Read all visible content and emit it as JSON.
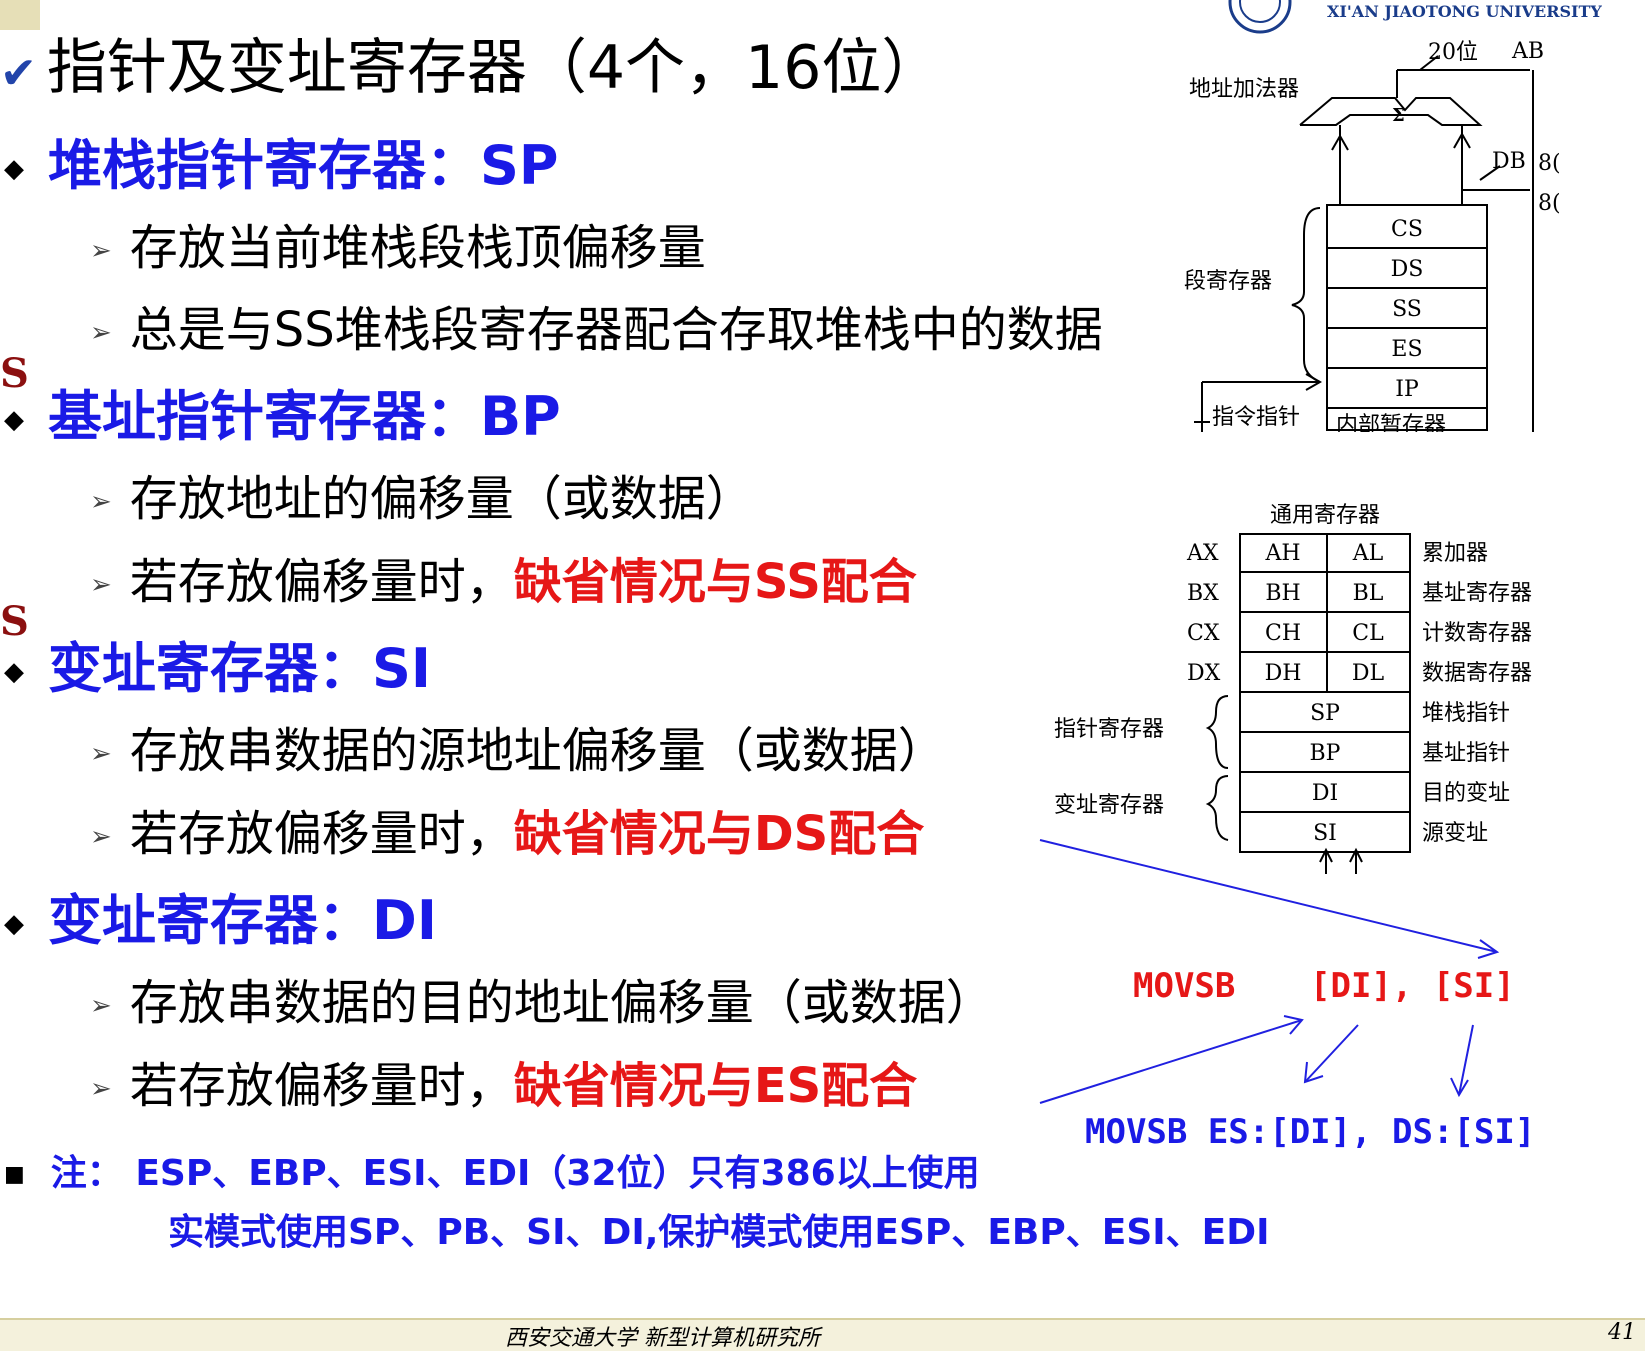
{
  "title": {
    "check_icon": "check-icon",
    "text": "指针及变址寄存器（4个，16位）"
  },
  "logo": {
    "name": "XI'AN JIAOTONG UNIVERSITY"
  },
  "sections": [
    {
      "heading": "堆栈指针寄存器：SP",
      "items": [
        {
          "text": "存放当前堆栈段栈顶偏移量"
        },
        {
          "text": "总是与SS堆栈段寄存器配合存取堆栈中的数据"
        }
      ]
    },
    {
      "heading": "基址指针寄存器：BP",
      "items": [
        {
          "text": "存放地址的偏移量（或数据）"
        },
        {
          "text": "若存放偏移量时，",
          "highlight": "缺省情况与SS配合"
        }
      ]
    },
    {
      "heading": "变址寄存器：SI",
      "items": [
        {
          "text": "存放串数据的源地址偏移量（或数据）"
        },
        {
          "text": "若存放偏移量时，",
          "highlight": "缺省情况与DS配合"
        }
      ]
    },
    {
      "heading": "变址寄存器：DI",
      "items": [
        {
          "text": "存放串数据的目的地址偏移量（或数据）"
        },
        {
          "text": "若存放偏移量时，",
          "highlight": "缺省情况与ES配合"
        }
      ]
    }
  ],
  "note": {
    "line1": "注： ESP、EBP、ESI、EDI（32位）只有386以上使用",
    "line2": "实模式使用SP、PB、SI、DI,保护模式使用ESP、EBP、ESI、EDI"
  },
  "left_cut_letters": [
    "S",
    "S"
  ],
  "code": {
    "movsb": "MOVSB",
    "operands": "[DI], [SI]",
    "full": "MOVSB ES:[DI], DS:[SI]"
  },
  "biu_diagram": {
    "adder_label": "地址加法器",
    "sigma": "Σ",
    "bus_ab": "20位",
    "ab": "AB",
    "db": "DB",
    "db_cut1": "8(",
    "db_cut2": "8(",
    "group_label": "段寄存器",
    "registers": [
      "CS",
      "DS",
      "SS",
      "ES",
      "IP"
    ],
    "pointer_label": "指令指针",
    "temp_label": "内部暂存器"
  },
  "eu_diagram": {
    "title": "通用寄存器",
    "general_rows": [
      {
        "name": "AX",
        "hi": "AH",
        "lo": "AL",
        "desc": "累加器"
      },
      {
        "name": "BX",
        "hi": "BH",
        "lo": "BL",
        "desc": "基址寄存器"
      },
      {
        "name": "CX",
        "hi": "CH",
        "lo": "CL",
        "desc": "计数寄存器"
      },
      {
        "name": "DX",
        "hi": "DH",
        "lo": "DL",
        "desc": "数据寄存器"
      }
    ],
    "wide_rows": [
      {
        "reg": "SP",
        "desc": "堆栈指针"
      },
      {
        "reg": "BP",
        "desc": "基址指针"
      },
      {
        "reg": "DI",
        "desc": "目的变址"
      },
      {
        "reg": "SI",
        "desc": "源变址"
      }
    ],
    "pointer_group": "指针寄存器",
    "index_group": "变址寄存器"
  },
  "footer": {
    "text": "西安交通大学 新型计算机研究所",
    "page": "41"
  },
  "colors": {
    "heading": "#1a1ae6",
    "highlight": "#e61717",
    "arrow": "#2020e0"
  }
}
